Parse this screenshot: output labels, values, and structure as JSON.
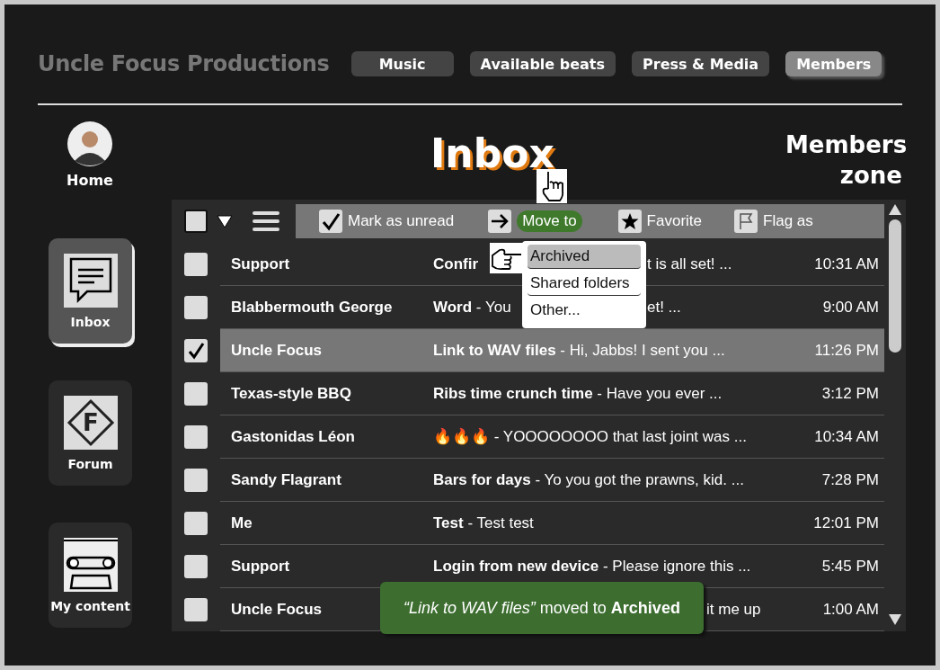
{
  "brand": "Uncle Focus Productions",
  "nav": [
    {
      "label": "Music",
      "selected": false
    },
    {
      "label": "Available beats",
      "selected": false
    },
    {
      "label": "Press & Media",
      "selected": false
    },
    {
      "label": "Members",
      "selected": true
    }
  ],
  "sidebar": {
    "home": "Home",
    "items": [
      {
        "label": "Inbox",
        "kind": "inbox",
        "selected": true
      },
      {
        "label": "Forum",
        "kind": "forum",
        "selected": false,
        "icon_letter": "F"
      },
      {
        "label": "My content",
        "kind": "content",
        "selected": false
      }
    ]
  },
  "page_title": "Inbox",
  "zone_label": "Members zone",
  "toolbar": {
    "select_all_checked": false,
    "actions": [
      {
        "label": "Mark as unread",
        "kind": "check",
        "active": false
      },
      {
        "label": "Move to",
        "kind": "move",
        "active": true
      },
      {
        "label": "Favorite",
        "kind": "star",
        "active": false
      },
      {
        "label": "Flag as",
        "kind": "flag",
        "active": false
      }
    ]
  },
  "move_menu": {
    "items": [
      {
        "label": "Archived",
        "selected": true
      },
      {
        "label": "Shared folders",
        "selected": false
      },
      {
        "label": "Other...",
        "selected": false
      }
    ]
  },
  "messages": [
    {
      "sender": "Support",
      "subject": "Confir",
      "preview_after": "t is all set! ...",
      "time": "10:31 AM",
      "checked": false
    },
    {
      "sender": "Blabbermouth George",
      "subject": "Word",
      "preview": "- You",
      "preview_after": "et! ...",
      "time": "9:00 AM",
      "checked": false
    },
    {
      "sender": "Uncle Focus",
      "subject": "Link to WAV files",
      "preview": "- Hi, Jabbs! I sent you ...",
      "time": "11:26 PM",
      "checked": true
    },
    {
      "sender": "Texas-style BBQ",
      "subject": "Ribs time crunch time",
      "preview": "- Have you ever ...",
      "time": "3:12 PM",
      "checked": false
    },
    {
      "sender": "Gastonidas Léon",
      "subject": "🔥🔥🔥",
      "preview": "- YOOOOOOOO that last joint was ...",
      "time": "10:34 AM",
      "checked": false
    },
    {
      "sender": "Sandy Flagrant",
      "subject": "Bars for days",
      "preview": "- Yo you got the prawns, kid. ...",
      "time": "7:28 PM",
      "checked": false
    },
    {
      "sender": "Me",
      "subject": "Test",
      "preview": "- Test test",
      "time": "12:01 PM",
      "checked": false
    },
    {
      "sender": "Support",
      "subject": "Login from new device",
      "preview": "- Please ignore this ...",
      "time": "5:45 PM",
      "checked": false
    },
    {
      "sender": "Uncle Focus",
      "preview_after": "it me up",
      "time": "1:00 AM",
      "checked": false
    }
  ],
  "toast": "*“Link to WAV files”* moved to **Archived**"
}
